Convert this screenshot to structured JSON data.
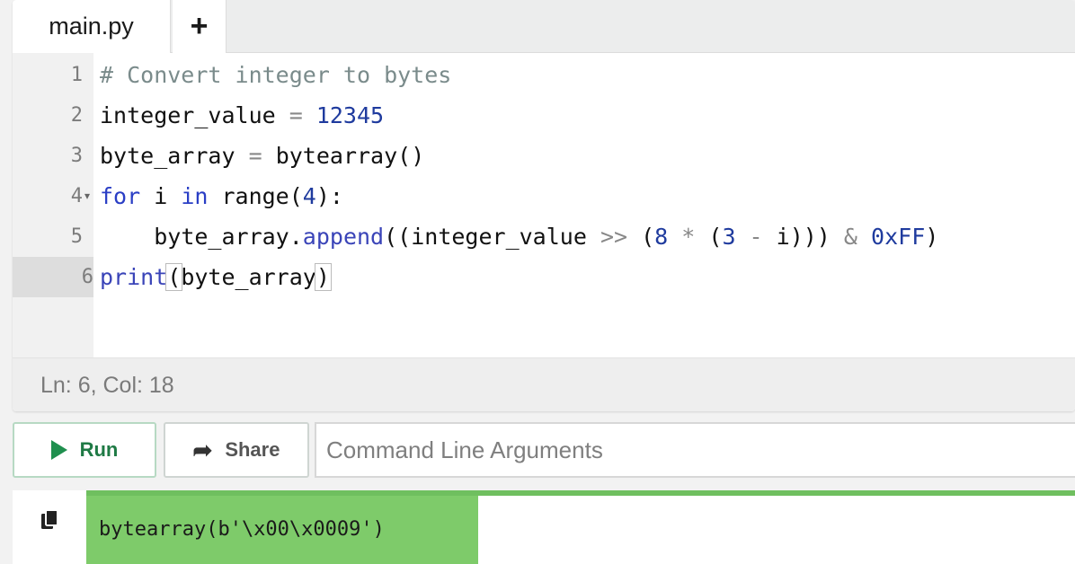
{
  "tabs": {
    "file_name": "main.py",
    "add_label": "+"
  },
  "editor": {
    "lines": [
      {
        "number": "1"
      },
      {
        "number": "2"
      },
      {
        "number": "3"
      },
      {
        "number": "4"
      },
      {
        "number": "5"
      },
      {
        "number": "6"
      }
    ],
    "code": {
      "l1": "# Convert integer to bytes",
      "l2_var": "integer_value ",
      "l2_op": "= ",
      "l2_num": "12345",
      "l3_var": "byte_array ",
      "l3_op": "= ",
      "l3_call": "bytearray()",
      "l4_for": "for",
      "l4_i": " i ",
      "l4_in": "in",
      "l4_range": " range(",
      "l4_num": "4",
      "l4_end": "):",
      "l5_indent": "    ",
      "l5_obj": "byte_array.",
      "l5_fn": "append",
      "l5_open": "((integer_value ",
      "l5_shift": ">>",
      "l5_paren": " (",
      "l5_num8": "8",
      "l5_mul": " * ",
      "l5_paren2": "(",
      "l5_num3": "3",
      "l5_minus": " - ",
      "l5_tail": "i))) ",
      "l5_amp": "&",
      "l5_space": " ",
      "l5_hex": "0xFF",
      "l5_close": ")",
      "l6_fn": "print",
      "l6_open": "(",
      "l6_arg": "byte_array",
      "l6_close": ")"
    },
    "status": "Ln: 6,  Col: 18"
  },
  "controls": {
    "run_label": "Run",
    "share_label": "Share",
    "args_placeholder": "Command Line Arguments"
  },
  "output": {
    "text": "bytearray(b'\\x00\\x0009')"
  },
  "colors": {
    "run_green": "#1f8f4e",
    "output_bg": "#7ecb6a",
    "keyword": "#2a3ec5"
  }
}
